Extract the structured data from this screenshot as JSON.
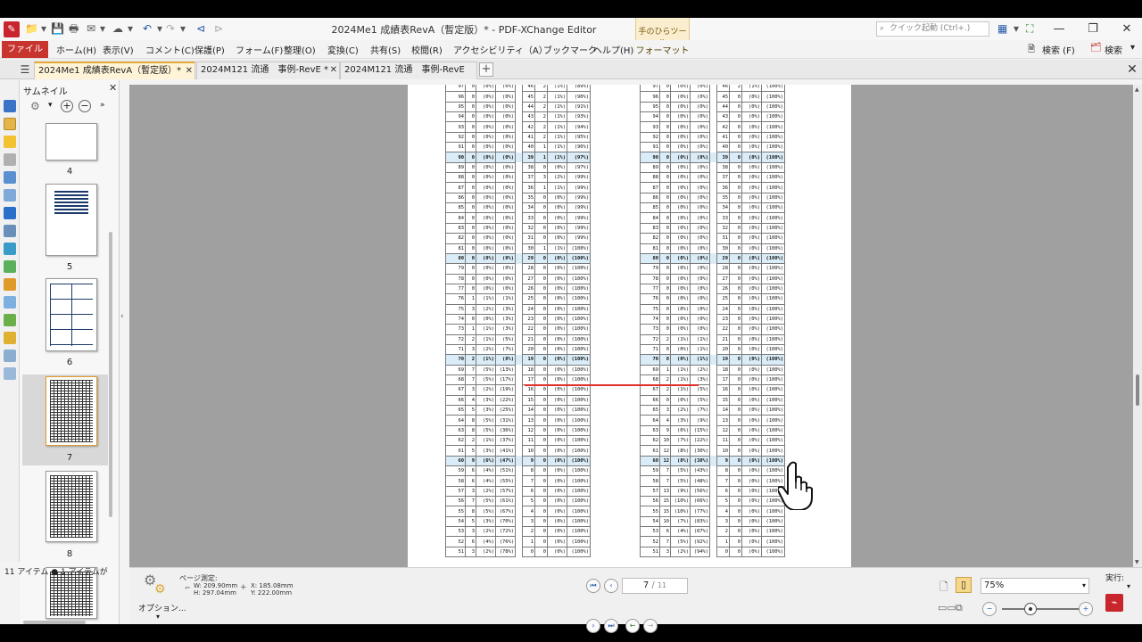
{
  "window": {
    "title": "2024Me1  成績表RevA（暫定版）* - PDF-XChange Editor",
    "quick_launch_placeholder": "クイック起動 (Ctrl+.)",
    "hand_tools_tab": "手のひらツール",
    "format_tab": "フォーマット"
  },
  "menu": {
    "file": "ファイル(F)",
    "items": [
      "ホーム(H)",
      "表示(V)",
      "コメント(C)",
      "保護(P)",
      "フォーム(F)",
      "整理(O)",
      "変換(C)",
      "共有(S)",
      "校閲(R)",
      "アクセシビリティ（A）",
      "ブックマーク",
      "ヘルプ(H)"
    ],
    "search1": "検索 (F)",
    "search2": "検索"
  },
  "tabs": [
    {
      "label": "2024Me1  成績表RevA（暫定版）*"
    },
    {
      "label": "2024M121  流通　事例-RevE *"
    },
    {
      "label": "2024M121  流通　事例-RevE"
    }
  ],
  "thumbnails": {
    "title": "サムネイル",
    "pages": [
      "4",
      "5",
      "6",
      "7",
      "8"
    ],
    "selected_page": "7",
    "footer": "11 アイテム ● 1 アイテムが"
  },
  "table": {
    "left": [
      [
        "97",
        "0",
        "(0%)",
        "(0%)",
        "46",
        "2",
        "(1%)",
        "(89%)"
      ],
      [
        "96",
        "0",
        "(0%)",
        "(0%)",
        "45",
        "2",
        "(1%)",
        "(90%)"
      ],
      [
        "95",
        "0",
        "(0%)",
        "(0%)",
        "44",
        "2",
        "(1%)",
        "(91%)"
      ],
      [
        "94",
        "0",
        "(0%)",
        "(0%)",
        "43",
        "2",
        "(1%)",
        "(93%)"
      ],
      [
        "93",
        "0",
        "(0%)",
        "(0%)",
        "42",
        "2",
        "(1%)",
        "(94%)"
      ],
      [
        "92",
        "0",
        "(0%)",
        "(0%)",
        "41",
        "2",
        "(1%)",
        "(95%)"
      ],
      [
        "91",
        "0",
        "(0%)",
        "(0%)",
        "40",
        "1",
        "(1%)",
        "(96%)"
      ],
      [
        "90",
        "0",
        "(0%)",
        "(0%)",
        "39",
        "1",
        "(1%)",
        "(97%)"
      ],
      [
        "89",
        "0",
        "(0%)",
        "(0%)",
        "38",
        "0",
        "(0%)",
        "(97%)"
      ],
      [
        "88",
        "0",
        "(0%)",
        "(0%)",
        "37",
        "3",
        "(2%)",
        "(99%)"
      ],
      [
        "87",
        "0",
        "(0%)",
        "(0%)",
        "36",
        "1",
        "(1%)",
        "(99%)"
      ],
      [
        "86",
        "0",
        "(0%)",
        "(0%)",
        "35",
        "0",
        "(0%)",
        "(99%)"
      ],
      [
        "85",
        "0",
        "(0%)",
        "(0%)",
        "34",
        "0",
        "(0%)",
        "(99%)"
      ],
      [
        "84",
        "0",
        "(0%)",
        "(0%)",
        "33",
        "0",
        "(0%)",
        "(99%)"
      ],
      [
        "83",
        "0",
        "(0%)",
        "(0%)",
        "32",
        "0",
        "(0%)",
        "(99%)"
      ],
      [
        "82",
        "0",
        "(0%)",
        "(0%)",
        "31",
        "0",
        "(0%)",
        "(99%)"
      ],
      [
        "81",
        "0",
        "(0%)",
        "(0%)",
        "30",
        "1",
        "(1%)",
        "(100%)"
      ],
      [
        "80",
        "0",
        "(0%)",
        "(0%)",
        "29",
        "0",
        "(0%)",
        "(100%)"
      ],
      [
        "79",
        "0",
        "(0%)",
        "(0%)",
        "28",
        "0",
        "(0%)",
        "(100%)"
      ],
      [
        "78",
        "0",
        "(0%)",
        "(0%)",
        "27",
        "0",
        "(0%)",
        "(100%)"
      ],
      [
        "77",
        "0",
        "(0%)",
        "(0%)",
        "26",
        "0",
        "(0%)",
        "(100%)"
      ],
      [
        "76",
        "1",
        "(1%)",
        "(1%)",
        "25",
        "0",
        "(0%)",
        "(100%)"
      ],
      [
        "75",
        "3",
        "(2%)",
        "(3%)",
        "24",
        "0",
        "(0%)",
        "(100%)"
      ],
      [
        "74",
        "0",
        "(0%)",
        "(3%)",
        "23",
        "0",
        "(0%)",
        "(100%)"
      ],
      [
        "73",
        "1",
        "(1%)",
        "(3%)",
        "22",
        "0",
        "(0%)",
        "(100%)"
      ],
      [
        "72",
        "2",
        "(1%)",
        "(5%)",
        "21",
        "0",
        "(0%)",
        "(100%)"
      ],
      [
        "71",
        "3",
        "(2%)",
        "(7%)",
        "20",
        "0",
        "(0%)",
        "(100%)"
      ],
      [
        "70",
        "2",
        "(1%)",
        "(8%)",
        "19",
        "0",
        "(0%)",
        "(100%)"
      ],
      [
        "69",
        "7",
        "(5%)",
        "(13%)",
        "18",
        "0",
        "(0%)",
        "(100%)"
      ],
      [
        "68",
        "7",
        "(5%)",
        "(17%)",
        "17",
        "0",
        "(0%)",
        "(100%)"
      ],
      [
        "67",
        "3",
        "(2%)",
        "(19%)",
        "16",
        "0",
        "(0%)",
        "(100%)"
      ],
      [
        "66",
        "4",
        "(3%)",
        "(22%)",
        "15",
        "0",
        "(0%)",
        "(100%)"
      ],
      [
        "65",
        "5",
        "(3%)",
        "(25%)",
        "14",
        "0",
        "(0%)",
        "(100%)"
      ],
      [
        "64",
        "8",
        "(5%)",
        "(31%)",
        "13",
        "0",
        "(0%)",
        "(100%)"
      ],
      [
        "63",
        "8",
        "(5%)",
        "(36%)",
        "12",
        "0",
        "(0%)",
        "(100%)"
      ],
      [
        "62",
        "2",
        "(1%)",
        "(37%)",
        "11",
        "0",
        "(0%)",
        "(100%)"
      ],
      [
        "61",
        "5",
        "(3%)",
        "(41%)",
        "10",
        "0",
        "(0%)",
        "(100%)"
      ],
      [
        "60",
        "9",
        "(6%)",
        "(47%)",
        "9",
        "0",
        "(0%)",
        "(100%)"
      ],
      [
        "59",
        "6",
        "(4%)",
        "(51%)",
        "8",
        "0",
        "(0%)",
        "(100%)"
      ],
      [
        "58",
        "6",
        "(4%)",
        "(55%)",
        "7",
        "0",
        "(0%)",
        "(100%)"
      ],
      [
        "57",
        "3",
        "(2%)",
        "(57%)",
        "6",
        "0",
        "(0%)",
        "(100%)"
      ],
      [
        "56",
        "7",
        "(5%)",
        "(61%)",
        "5",
        "0",
        "(0%)",
        "(100%)"
      ],
      [
        "55",
        "8",
        "(5%)",
        "(67%)",
        "4",
        "0",
        "(0%)",
        "(100%)"
      ],
      [
        "54",
        "5",
        "(3%)",
        "(70%)",
        "3",
        "0",
        "(0%)",
        "(100%)"
      ],
      [
        "53",
        "3",
        "(2%)",
        "(72%)",
        "2",
        "0",
        "(0%)",
        "(100%)"
      ],
      [
        "52",
        "6",
        "(4%)",
        "(76%)",
        "1",
        "0",
        "(0%)",
        "(100%)"
      ],
      [
        "51",
        "3",
        "(2%)",
        "(78%)",
        "0",
        "0",
        "(0%)",
        "(100%)"
      ]
    ],
    "right": [
      [
        "97",
        "0",
        "(0%)",
        "(0%)",
        "46",
        "2",
        "(1%)",
        "(100%)"
      ],
      [
        "96",
        "0",
        "(0%)",
        "(0%)",
        "45",
        "0",
        "(0%)",
        "(100%)"
      ],
      [
        "95",
        "0",
        "(0%)",
        "(0%)",
        "44",
        "0",
        "(0%)",
        "(100%)"
      ],
      [
        "94",
        "0",
        "(0%)",
        "(0%)",
        "43",
        "0",
        "(0%)",
        "(100%)"
      ],
      [
        "93",
        "0",
        "(0%)",
        "(0%)",
        "42",
        "0",
        "(0%)",
        "(100%)"
      ],
      [
        "92",
        "0",
        "(0%)",
        "(0%)",
        "41",
        "0",
        "(0%)",
        "(100%)"
      ],
      [
        "91",
        "0",
        "(0%)",
        "(0%)",
        "40",
        "0",
        "(0%)",
        "(100%)"
      ],
      [
        "90",
        "0",
        "(0%)",
        "(0%)",
        "39",
        "0",
        "(0%)",
        "(100%)"
      ],
      [
        "89",
        "0",
        "(0%)",
        "(0%)",
        "38",
        "0",
        "(0%)",
        "(100%)"
      ],
      [
        "88",
        "0",
        "(0%)",
        "(0%)",
        "37",
        "0",
        "(0%)",
        "(100%)"
      ],
      [
        "87",
        "0",
        "(0%)",
        "(0%)",
        "36",
        "0",
        "(0%)",
        "(100%)"
      ],
      [
        "86",
        "0",
        "(0%)",
        "(0%)",
        "35",
        "0",
        "(0%)",
        "(100%)"
      ],
      [
        "85",
        "0",
        "(0%)",
        "(0%)",
        "34",
        "0",
        "(0%)",
        "(100%)"
      ],
      [
        "84",
        "0",
        "(0%)",
        "(0%)",
        "33",
        "0",
        "(0%)",
        "(100%)"
      ],
      [
        "83",
        "0",
        "(0%)",
        "(0%)",
        "32",
        "0",
        "(0%)",
        "(100%)"
      ],
      [
        "82",
        "0",
        "(0%)",
        "(0%)",
        "31",
        "0",
        "(0%)",
        "(100%)"
      ],
      [
        "81",
        "0",
        "(0%)",
        "(0%)",
        "30",
        "0",
        "(0%)",
        "(100%)"
      ],
      [
        "80",
        "0",
        "(0%)",
        "(0%)",
        "29",
        "0",
        "(0%)",
        "(100%)"
      ],
      [
        "79",
        "0",
        "(0%)",
        "(0%)",
        "28",
        "0",
        "(0%)",
        "(100%)"
      ],
      [
        "78",
        "0",
        "(0%)",
        "(0%)",
        "27",
        "0",
        "(0%)",
        "(100%)"
      ],
      [
        "77",
        "0",
        "(0%)",
        "(0%)",
        "26",
        "0",
        "(0%)",
        "(100%)"
      ],
      [
        "76",
        "0",
        "(0%)",
        "(0%)",
        "25",
        "0",
        "(0%)",
        "(100%)"
      ],
      [
        "75",
        "0",
        "(0%)",
        "(0%)",
        "24",
        "0",
        "(0%)",
        "(100%)"
      ],
      [
        "74",
        "0",
        "(0%)",
        "(0%)",
        "23",
        "0",
        "(0%)",
        "(100%)"
      ],
      [
        "73",
        "0",
        "(0%)",
        "(0%)",
        "22",
        "0",
        "(0%)",
        "(100%)"
      ],
      [
        "72",
        "2",
        "(1%)",
        "(1%)",
        "21",
        "0",
        "(0%)",
        "(100%)"
      ],
      [
        "71",
        "0",
        "(0%)",
        "(1%)",
        "20",
        "0",
        "(0%)",
        "(100%)"
      ],
      [
        "70",
        "0",
        "(0%)",
        "(1%)",
        "19",
        "0",
        "(0%)",
        "(100%)"
      ],
      [
        "69",
        "1",
        "(1%)",
        "(2%)",
        "18",
        "0",
        "(0%)",
        "(100%)"
      ],
      [
        "68",
        "2",
        "(1%)",
        "(3%)",
        "17",
        "0",
        "(0%)",
        "(100%)"
      ],
      [
        "67",
        "2",
        "(1%)",
        "(5%)",
        "16",
        "0",
        "(0%)",
        "(100%)"
      ],
      [
        "66",
        "0",
        "(0%)",
        "(5%)",
        "15",
        "0",
        "(0%)",
        "(100%)"
      ],
      [
        "65",
        "3",
        "(2%)",
        "(7%)",
        "14",
        "0",
        "(0%)",
        "(100%)"
      ],
      [
        "64",
        "4",
        "(3%)",
        "(9%)",
        "13",
        "0",
        "(0%)",
        "(100%)"
      ],
      [
        "63",
        "9",
        "(6%)",
        "(15%)",
        "12",
        "0",
        "(0%)",
        "(100%)"
      ],
      [
        "62",
        "10",
        "(7%)",
        "(22%)",
        "11",
        "0",
        "(0%)",
        "(100%)"
      ],
      [
        "61",
        "12",
        "(8%)",
        "(30%)",
        "10",
        "0",
        "(0%)",
        "(100%)"
      ],
      [
        "60",
        "12",
        "(8%)",
        "(38%)",
        "9",
        "0",
        "(0%)",
        "(100%)"
      ],
      [
        "59",
        "7",
        "(5%)",
        "(43%)",
        "8",
        "0",
        "(0%)",
        "(100%)"
      ],
      [
        "58",
        "7",
        "(5%)",
        "(48%)",
        "7",
        "0",
        "(0%)",
        "(100%)"
      ],
      [
        "57",
        "13",
        "(9%)",
        "(56%)",
        "6",
        "0",
        "(0%)",
        "(100%)"
      ],
      [
        "56",
        "15",
        "(10%)",
        "(66%)",
        "5",
        "0",
        "(0%)",
        "(100%)"
      ],
      [
        "55",
        "15",
        "(10%)",
        "(77%)",
        "4",
        "0",
        "(0%)",
        "(100%)"
      ],
      [
        "54",
        "10",
        "(7%)",
        "(83%)",
        "3",
        "0",
        "(0%)",
        "(100%)"
      ],
      [
        "53",
        "6",
        "(4%)",
        "(87%)",
        "2",
        "0",
        "(0%)",
        "(100%)"
      ],
      [
        "52",
        "7",
        "(5%)",
        "(92%)",
        "1",
        "0",
        "(0%)",
        "(100%)"
      ],
      [
        "51",
        "3",
        "(2%)",
        "(94%)",
        "0",
        "0",
        "(0%)",
        "(100%)"
      ]
    ],
    "highlight_rows": [
      "90",
      "80",
      "70",
      "60"
    ]
  },
  "status": {
    "options_label": "オプション...",
    "page_measure_label": "ページ測定:",
    "width": "W: 209.90mm",
    "height": "H: 297.04mm",
    "x": "X: 185.08mm",
    "y": "Y: 222.00mm",
    "current_page": "7",
    "total_pages": "11",
    "zoom": "75%",
    "run_label": "実行:"
  },
  "colors": {
    "accent_red": "#c8352f",
    "active_tab": "#fff4d8",
    "highlight_row": "#d9ecf7",
    "annotation_red": "#e0302a"
  }
}
